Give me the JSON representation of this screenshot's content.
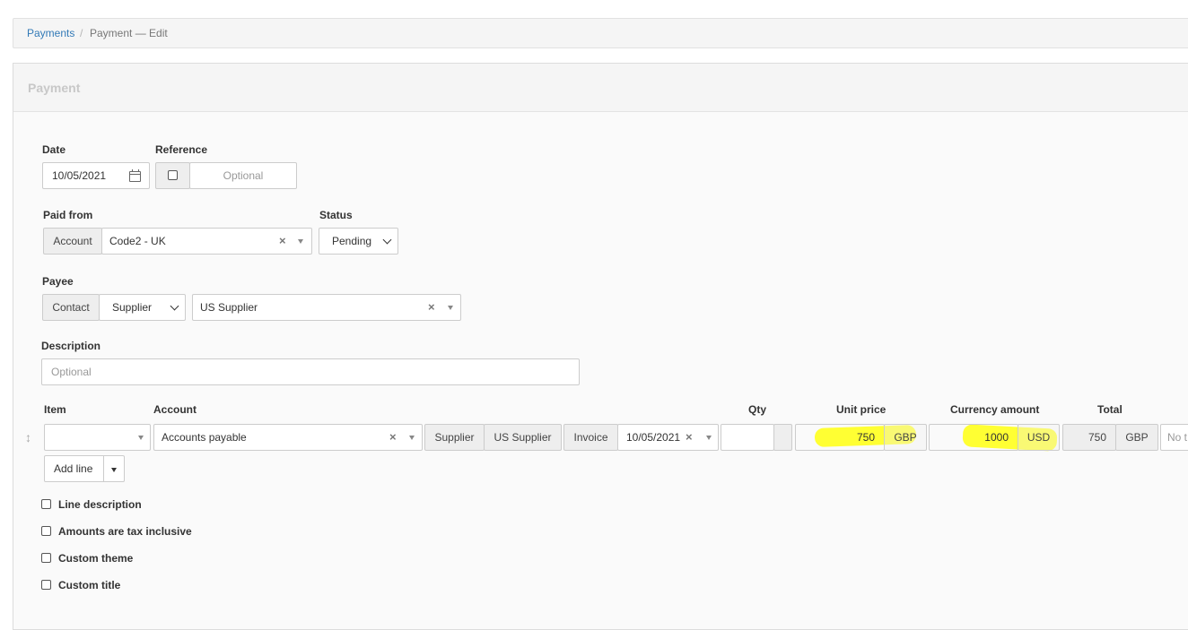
{
  "breadcrumb": {
    "parent": "Payments",
    "separator": "/",
    "current": "Payment — Edit"
  },
  "panel": {
    "title": "Payment"
  },
  "form": {
    "date": {
      "label": "Date",
      "value": "10/05/2021",
      "icon": "calendar-icon"
    },
    "reference": {
      "label": "Reference",
      "placeholder": "Optional"
    },
    "paid_from": {
      "label": "Paid from",
      "addon": "Account",
      "value": "Code2 - UK"
    },
    "status": {
      "label": "Status",
      "value": "Pending"
    },
    "payee": {
      "label": "Payee",
      "addon": "Contact",
      "type": "Supplier",
      "value": "US Supplier"
    },
    "description": {
      "label": "Description",
      "placeholder": "Optional"
    }
  },
  "lines": {
    "headers": {
      "item": "Item",
      "account": "Account",
      "qty": "Qty",
      "unit_price": "Unit price",
      "currency_amount": "Currency amount",
      "total": "Total"
    },
    "row": {
      "account": "Accounts payable",
      "supplier_label": "Supplier",
      "supplier_value": "US Supplier",
      "invoice_label": "Invoice",
      "invoice_value": "10/05/2021",
      "unit_price": "750",
      "unit_currency": "GBP",
      "currency_amount": "1000",
      "amount_currency": "USD",
      "total": "750",
      "total_currency": "GBP",
      "tax_placeholder": "No t"
    },
    "add_line": "Add line"
  },
  "options": [
    {
      "label": "Line description"
    },
    {
      "label": "Amounts are tax inclusive"
    },
    {
      "label": "Custom theme"
    },
    {
      "label": "Custom title"
    }
  ],
  "colors": {
    "link": "#337ab7",
    "highlight": "#ffff22",
    "addon_bg": "#eeeeee"
  }
}
